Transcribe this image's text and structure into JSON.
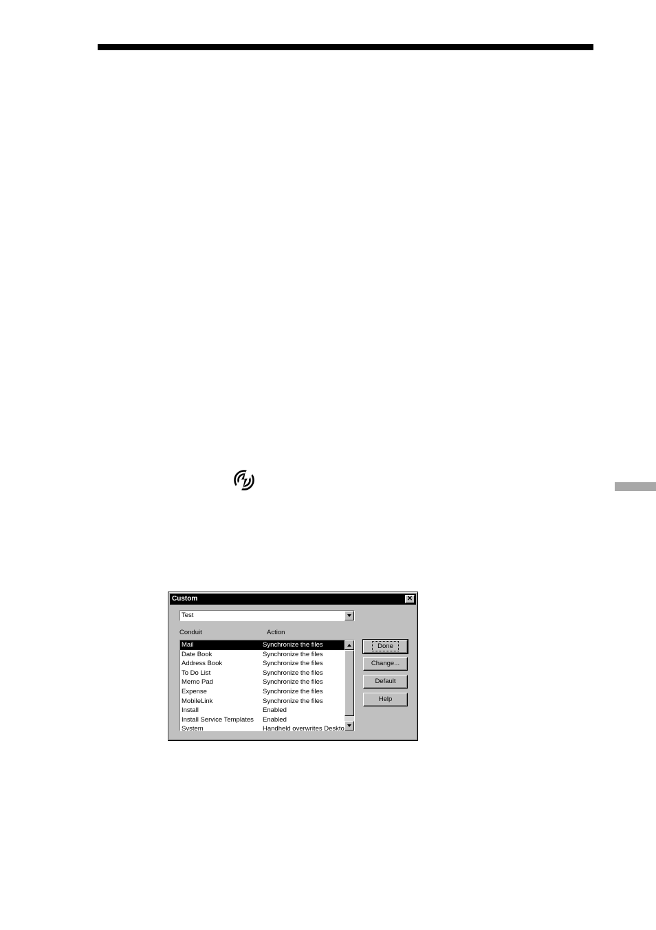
{
  "dialog": {
    "title": "Custom",
    "close_label": "✕",
    "profile_select": {
      "value": "Test"
    },
    "columns": {
      "conduit": "Conduit",
      "action": "Action"
    },
    "rows": [
      {
        "conduit": "Mail",
        "action": "Synchronize the files",
        "selected": true
      },
      {
        "conduit": "Date Book",
        "action": "Synchronize the files"
      },
      {
        "conduit": "Address Book",
        "action": "Synchronize the files"
      },
      {
        "conduit": "To Do List",
        "action": "Synchronize the files"
      },
      {
        "conduit": "Memo Pad",
        "action": "Synchronize the files"
      },
      {
        "conduit": "Expense",
        "action": "Synchronize the files"
      },
      {
        "conduit": "MobileLink",
        "action": "Synchronize the files"
      },
      {
        "conduit": "Install",
        "action": "Enabled"
      },
      {
        "conduit": "Install Service Templates",
        "action": "Enabled"
      },
      {
        "conduit": "System",
        "action": "Handheld overwrites Desktop"
      }
    ],
    "buttons": {
      "done": "Done",
      "change": "Change...",
      "default": "Default",
      "help": "Help"
    }
  },
  "icons": {
    "hotsync": "hotsync-icon"
  }
}
